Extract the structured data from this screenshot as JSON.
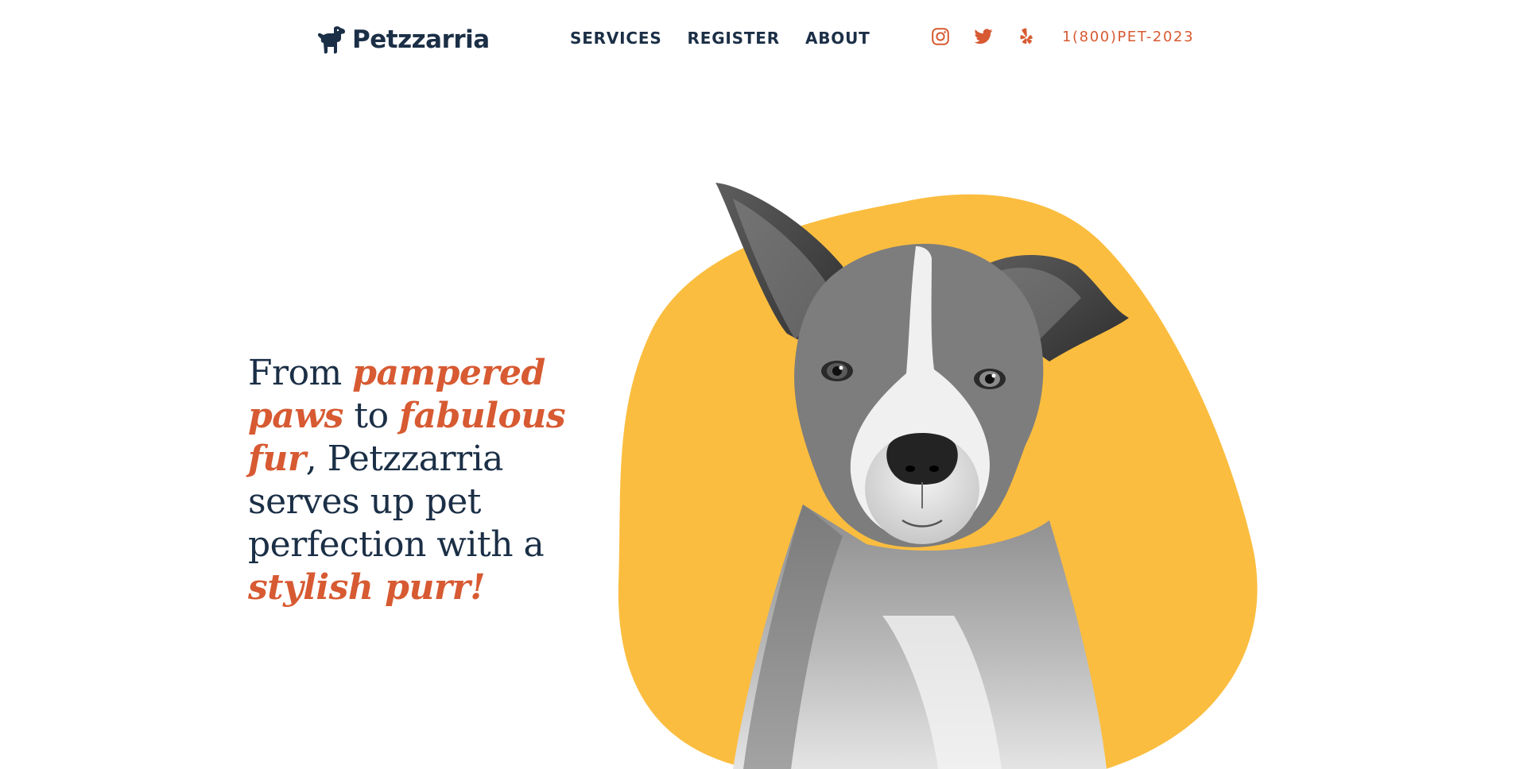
{
  "brand": {
    "name": "Petzzarria",
    "icon": "dog-icon"
  },
  "nav": {
    "items": [
      {
        "label": "SERVICES"
      },
      {
        "label": "REGISTER"
      },
      {
        "label": "ABOUT"
      }
    ]
  },
  "social": {
    "icons": [
      "instagram-icon",
      "twitter-icon",
      "yelp-icon"
    ],
    "phone": "1(800)PET-2023"
  },
  "hero": {
    "headline_parts": [
      {
        "text": "From ",
        "emphasis": false
      },
      {
        "text": "pampered paws",
        "emphasis": true
      },
      {
        "text": " to ",
        "emphasis": false
      },
      {
        "text": "fabulous fur",
        "emphasis": true
      },
      {
        "text": ", Petzzarria serves up pet perfection with a ",
        "emphasis": false
      },
      {
        "text": "stylish purr!",
        "emphasis": true
      }
    ],
    "image": "black-and-white dog portrait on yellow blob"
  },
  "colors": {
    "navy": "#1b2f46",
    "accent": "#d75a32",
    "blob_yellow": "#fbbd3f",
    "background": "#ffffff"
  }
}
